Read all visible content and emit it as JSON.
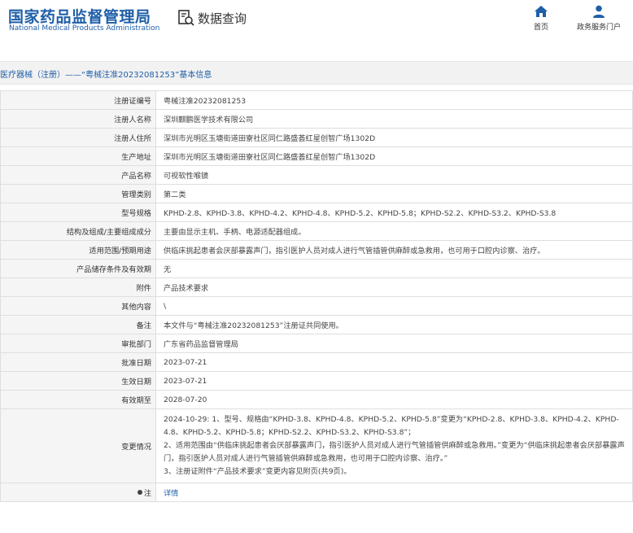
{
  "header": {
    "logo_cn": "国家药品监督管理局",
    "logo_en": "National Medical Products Administration",
    "query_label": "数据查询",
    "nav": [
      {
        "label": "首页",
        "icon": "home-icon"
      },
      {
        "label": "政务服务门户",
        "icon": "user-icon"
      }
    ]
  },
  "title": "医疗器械（注册）——“粤械注准20232081253”基本信息",
  "rows": [
    {
      "label": "注册证编号",
      "value": "粤械注准20232081253"
    },
    {
      "label": "注册人名称",
      "value": "深圳麒鹏医学技术有限公司"
    },
    {
      "label": "注册人住所",
      "value": "深圳市光明区玉塘街道田寮社区同仁路盛荟红星创智广场1302D"
    },
    {
      "label": "生产地址",
      "value": "深圳市光明区玉塘街道田寮社区同仁路盛荟红星创智广场1302D"
    },
    {
      "label": "产品名称",
      "value": "可视软性喉镜"
    },
    {
      "label": "管理类别",
      "value": "第二类"
    },
    {
      "label": "型号规格",
      "value": "KPHD-2.8、KPHD-3.8、KPHD-4.2、KPHD-4.8、KPHD-5.2、KPHD-5.8；KPHD-S2.2、KPHD-S3.2、KPHD-S3.8"
    },
    {
      "label": "结构及组成/主要组成成分",
      "value": "主要由显示主机、手柄、电源适配器组成。"
    },
    {
      "label": "适用范围/预期用途",
      "value": "供临床挑起患者会厌部暴露声门，指引医护人员对成人进行气管插管供麻醉或急救用，也可用于口腔内诊察、治疗。"
    },
    {
      "label": "产品储存条件及有效期",
      "value": "无"
    },
    {
      "label": "附件",
      "value": "产品技术要求"
    },
    {
      "label": "其他内容",
      "value": "\\"
    },
    {
      "label": "备注",
      "value": "本文件与“粤械注准20232081253”注册证共同使用。"
    },
    {
      "label": "审批部门",
      "value": "广东省药品监督管理局"
    },
    {
      "label": "批准日期",
      "value": "2023-07-21"
    },
    {
      "label": "生效日期",
      "value": "2023-07-21"
    },
    {
      "label": "有效期至",
      "value": "2028-07-20"
    }
  ],
  "change": {
    "label": "变更情况",
    "lines": [
      "2024-10-29: 1、型号、规格由“KPHD-3.8、KPHD-4.8、KPHD-5.2、KPHD-5.8”变更为“KPHD-2.8、KPHD-3.8、KPHD-4.2、KPHD-4.8、KPHD-5.2、KPHD-5.8；KPHD-S2.2、KPHD-S3.2、KPHD-S3.8”；",
      "2、适用范围由“供临床挑起患者会厌部暴露声门，指引医护人员对成人进行气管插管供麻醉或急救用。”变更为“供临床挑起患者会厌部暴露声门，指引医护人员对成人进行气管插管供麻醉或急救用，也可用于口腔内诊察、治疗。”",
      "3、注册证附件“产品技术要求”变更内容见附页(共9页)。"
    ]
  },
  "note": {
    "label": "注",
    "link": "详情"
  }
}
